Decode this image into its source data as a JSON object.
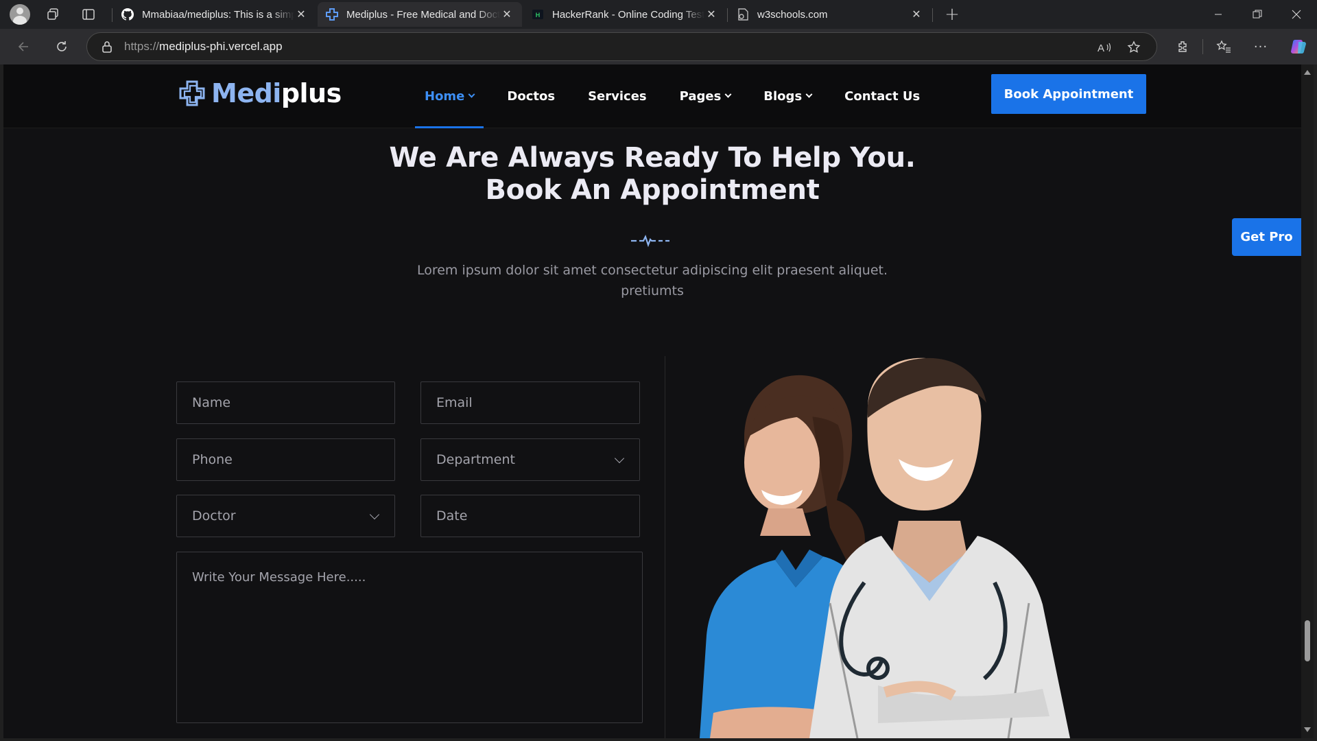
{
  "browser": {
    "tabs": [
      {
        "title": "Mmabiaa/mediplus: This is a simple",
        "favicon": "github-icon"
      },
      {
        "title": "Mediplus - Free Medical and Doctor",
        "favicon": "mediplus-icon"
      },
      {
        "title": "HackerRank - Online Coding Tests",
        "favicon": "hackerrank-icon"
      },
      {
        "title": "w3schools.com",
        "favicon": "w3schools-icon"
      }
    ],
    "address": {
      "prefix": "https://",
      "host": "mediplus-phi.vercel.app"
    }
  },
  "site": {
    "logo": {
      "main": "Medi",
      "accent": "plus"
    },
    "menu": [
      {
        "label": "Home",
        "dropdown": true,
        "active": true
      },
      {
        "label": "Doctos",
        "dropdown": false
      },
      {
        "label": "Services",
        "dropdown": false
      },
      {
        "label": "Pages",
        "dropdown": true
      },
      {
        "label": "Blogs",
        "dropdown": true
      },
      {
        "label": "Contact Us",
        "dropdown": false
      }
    ],
    "book_button": "Book Appointment",
    "get_pro": "Get Pro"
  },
  "section": {
    "title_line1": "We Are Always Ready To Help You.",
    "title_line2": "Book An Appointment",
    "description": "Lorem ipsum dolor sit amet consectetur adipiscing elit praesent aliquet. pretiumts"
  },
  "form": {
    "name": "Name",
    "email": "Email",
    "phone": "Phone",
    "department": "Department",
    "doctor": "Doctor",
    "date": "Date",
    "message": "Write Your Message Here....."
  },
  "colors": {
    "accent": "#1a73e8",
    "background": "#111113",
    "text": "#ecebf4"
  }
}
